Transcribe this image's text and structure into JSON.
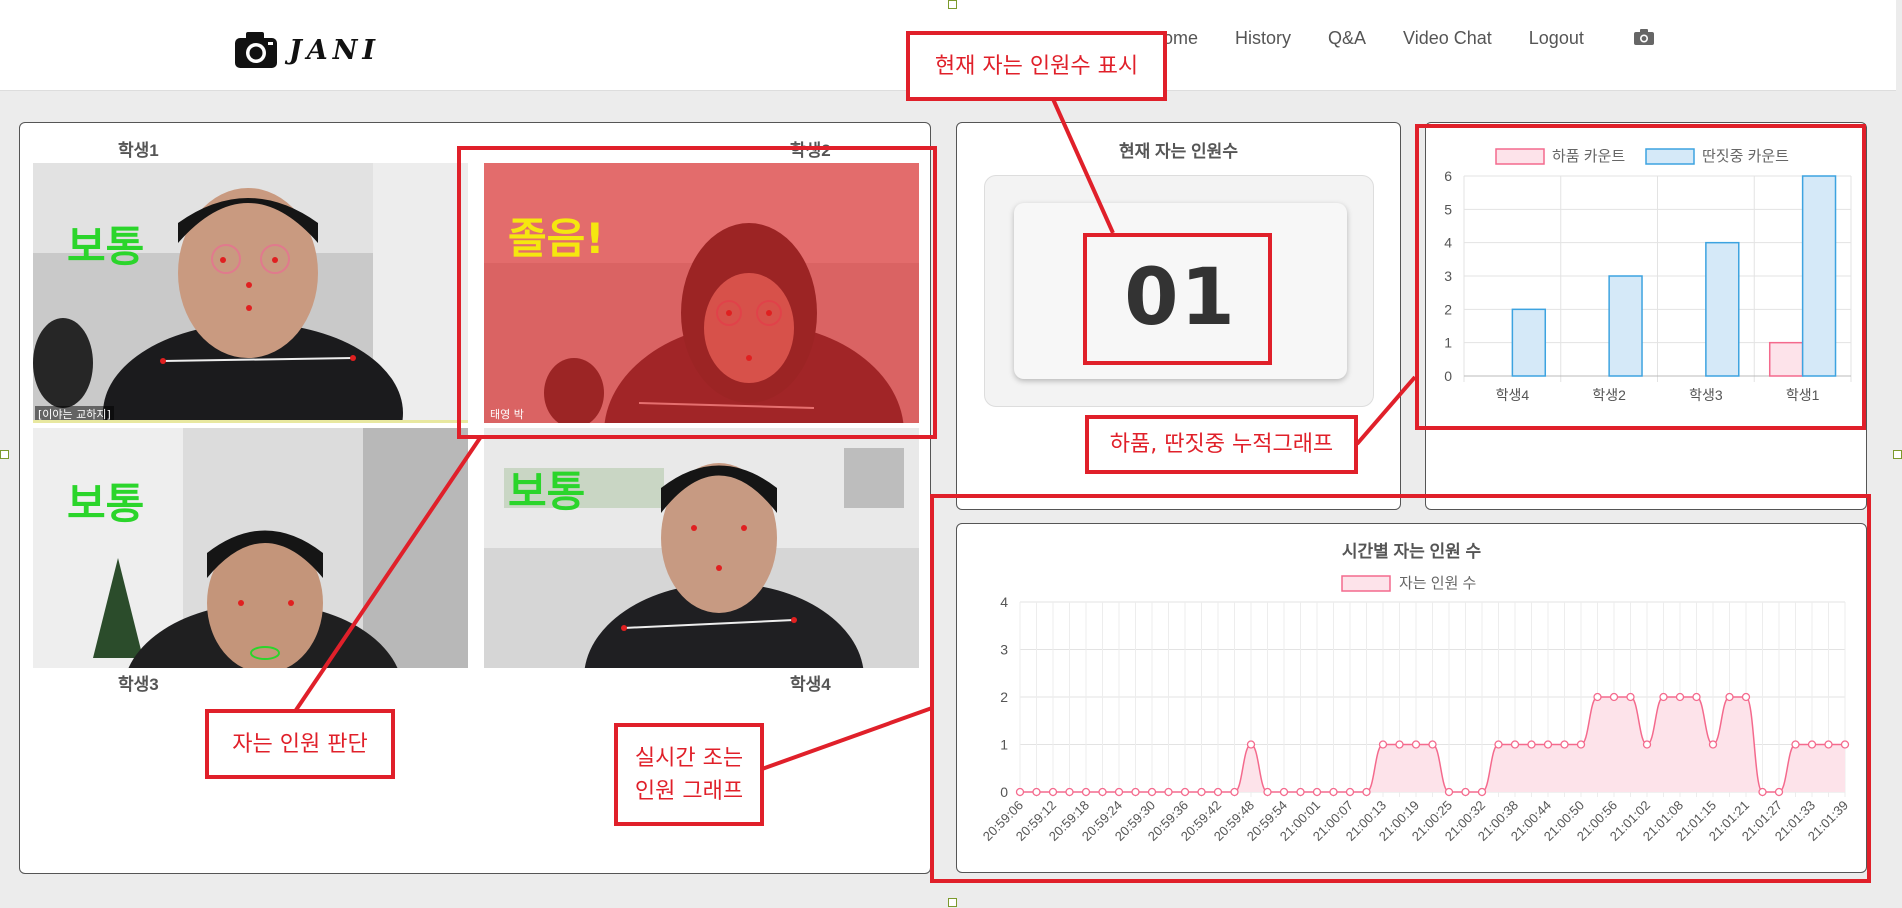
{
  "brand": {
    "name": "JANI",
    "icon": "camera-icon"
  },
  "nav": {
    "links": [
      "Home",
      "History",
      "Q&A",
      "Video Chat",
      "Logout"
    ],
    "camera_icon": "camera-icon"
  },
  "video_grid": {
    "labels": [
      "학생1",
      "학생2",
      "학생3",
      "학생4"
    ],
    "feeds": [
      {
        "status": "보통",
        "status_color": "#2bd52b",
        "caption": "[이야는 교하지]",
        "highlight": false
      },
      {
        "status": "졸음!",
        "status_color": "#f5e70f",
        "caption": "태영 박",
        "highlight": true
      },
      {
        "status": "보통",
        "status_color": "#2bd52b",
        "caption": "",
        "highlight": false
      },
      {
        "status": "보통",
        "status_color": "#2bd52b",
        "caption": "",
        "highlight": false
      }
    ]
  },
  "count_panel": {
    "title": "현재 자는 인원수",
    "value": "01"
  },
  "bar_chart": {
    "chart_data": {
      "type": "bar",
      "categories": [
        "학생4",
        "학생2",
        "학생3",
        "학생1"
      ],
      "series": [
        {
          "name": "하품 카운트",
          "values": [
            0,
            0,
            0,
            1
          ],
          "color": "#f46a8d",
          "fill": "#fde3ea"
        },
        {
          "name": "딴짓중 카운트",
          "values": [
            2,
            3,
            4,
            6
          ],
          "color": "#3da3e0",
          "fill": "#d5e9f8"
        }
      ],
      "ylim": [
        0,
        6
      ],
      "yticks": [
        0,
        1,
        2,
        3,
        4,
        5,
        6
      ],
      "grid": true,
      "legend": "top"
    }
  },
  "line_chart": {
    "title": "시간별 자는 인원 수",
    "chart_data": {
      "type": "area",
      "title": "시간별 자는 인원 수",
      "x_labels": [
        "20:59:06",
        "20:59:12",
        "20:59:18",
        "20:59:24",
        "20:59:30",
        "20:59:36",
        "20:59:42",
        "20:59:48",
        "20:59:54",
        "21:00:01",
        "21:00:07",
        "21:00:13",
        "21:00:19",
        "21:00:25",
        "21:00:32",
        "21:00:38",
        "21:00:44",
        "21:00:50",
        "21:00:56",
        "21:01:02",
        "21:01:08",
        "21:01:15",
        "21:01:21",
        "21:01:27",
        "21:01:33",
        "21:01:39"
      ],
      "series": [
        {
          "name": "자는 인원 수",
          "values": [
            0,
            0,
            0,
            0,
            0,
            0,
            0,
            0,
            0,
            0,
            0,
            0,
            0,
            0,
            1,
            0,
            0,
            0,
            0,
            0,
            0,
            0,
            1,
            1,
            1,
            1,
            0,
            0,
            0,
            1,
            1,
            1,
            1,
            1,
            1,
            2,
            2,
            2,
            1,
            2,
            2,
            2,
            1,
            2,
            2,
            0,
            0,
            1,
            1,
            1,
            1
          ],
          "color": "#f46a8d",
          "fill": "#fde3ea"
        }
      ],
      "ylim": [
        0,
        4
      ],
      "yticks": [
        0,
        1,
        2,
        3,
        4
      ],
      "grid": true,
      "legend": "top"
    }
  },
  "annotations": [
    {
      "key": "count",
      "text": "현재 자는 인원수 표시"
    },
    {
      "key": "bar",
      "text": "하품, 딴짓중 누적그래프"
    },
    {
      "key": "judge",
      "text": "자는 인원 판단"
    },
    {
      "key": "realtime",
      "text": "실시간 조는\n인원 그래프"
    }
  ],
  "colors": {
    "annotation": "#e0202a",
    "accent_pink": "#f46a8d",
    "accent_blue": "#3da3e0"
  }
}
